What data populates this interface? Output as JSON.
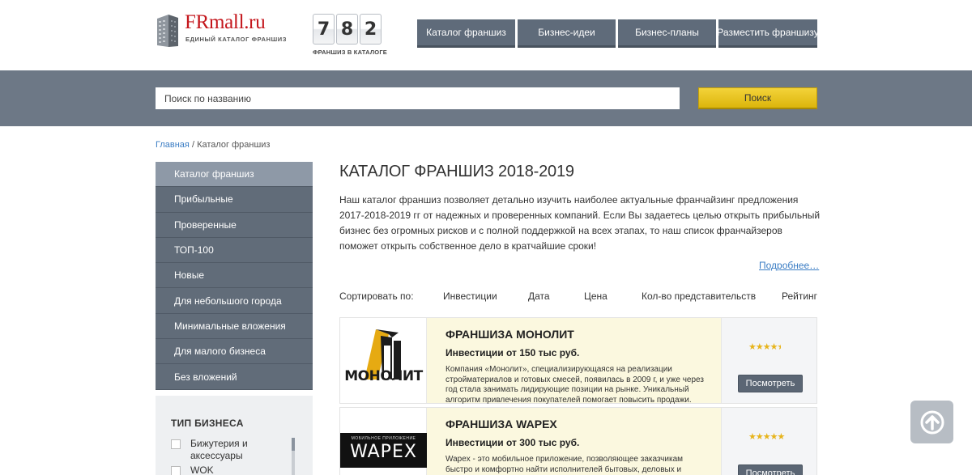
{
  "header": {
    "logo_title": "FRmall.ru",
    "logo_subtitle": "ЕДИНЫЙ КАТАЛОГ ФРАНШИЗ",
    "counter_digits": [
      "7",
      "8",
      "2"
    ],
    "counter_label": "ФРАНШИЗ В КАТАЛОГЕ",
    "nav": [
      "Каталог франшиз",
      "Бизнес-идеи",
      "Бизнес-планы",
      "Разместить франшизу"
    ]
  },
  "search": {
    "placeholder": "Поиск по названию",
    "button": "Поиск"
  },
  "breadcrumb": {
    "home": "Главная",
    "separator": "/",
    "current": "Каталог франшиз"
  },
  "sidebar": {
    "items": [
      "Каталог франшиз",
      "Прибыльные",
      "Проверенные",
      "ТОП-100",
      "Новые",
      "Для небольшого города",
      "Минимальные вложения",
      "Для малого бизнеса",
      "Без вложений"
    ],
    "active_index": 0,
    "filter_title": "ТИП БИЗНЕСА",
    "filter_options": [
      "Бижутерия и аксессуары",
      "WOK"
    ]
  },
  "main": {
    "title": "КАТАЛОГ ФРАНШИЗ 2018-2019",
    "intro": "Наш каталог франшиз позволяет детально изучить наиболее актуальные франчайзинг предложения 2017-2018-2019 гг от надежных и проверенных компаний. Если Вы задаетесь целью открыть прибыльный бизнес без огромных рисков и с полной поддержкой на всех этапах, то наш список франчайзеров поможет открыть собственное дело в кратчайшие сроки!",
    "more": "Подробнее…",
    "sort_label": "Сортировать по:",
    "sort_options": [
      "Инвестиции",
      "Дата",
      "Цена",
      "Кол-во представительств",
      "Рейтинг"
    ]
  },
  "cards": [
    {
      "logo_text": "МОНОЛИТ",
      "title": "ФРАНШИЗА МОНОЛИТ",
      "investment": "Инвестиции от 150 тыс руб.",
      "description": "Компания «Монолит», специализирующаяся на реализации стройматериалов и готовых смесей, появилась в 2009 г, и уже через год стала занимать лидирующие позиции на рынке. Уникальный алгоритм привлечения покупателей помогает повысить продажи.",
      "rating": 4.5,
      "button": "Посмотреть"
    },
    {
      "logo_small": "МОБИЛЬНОЕ ПРИЛОЖЕНИЕ",
      "logo_text": "WAPEX",
      "title": "ФРАНШИЗА WAPEX",
      "investment": "Инвестиции от 300 тыс руб.",
      "description": "Wapex - это мобильное приложение, позволяющее заказчикам быстро и комфортно найти исполнителей бытовых, деловых и прочих услуг при помощи приложения для смартфона.",
      "rating": 5,
      "button": "Посмотреть"
    }
  ],
  "colors": {
    "brand_red": "#c4161c",
    "nav_gray": "#5f6b7a",
    "search_band": "#6d7886",
    "search_button": "#e6c21a",
    "card_highlight": "#fbf8df",
    "star": "#e7b41c",
    "link": "#3b7dc4"
  }
}
